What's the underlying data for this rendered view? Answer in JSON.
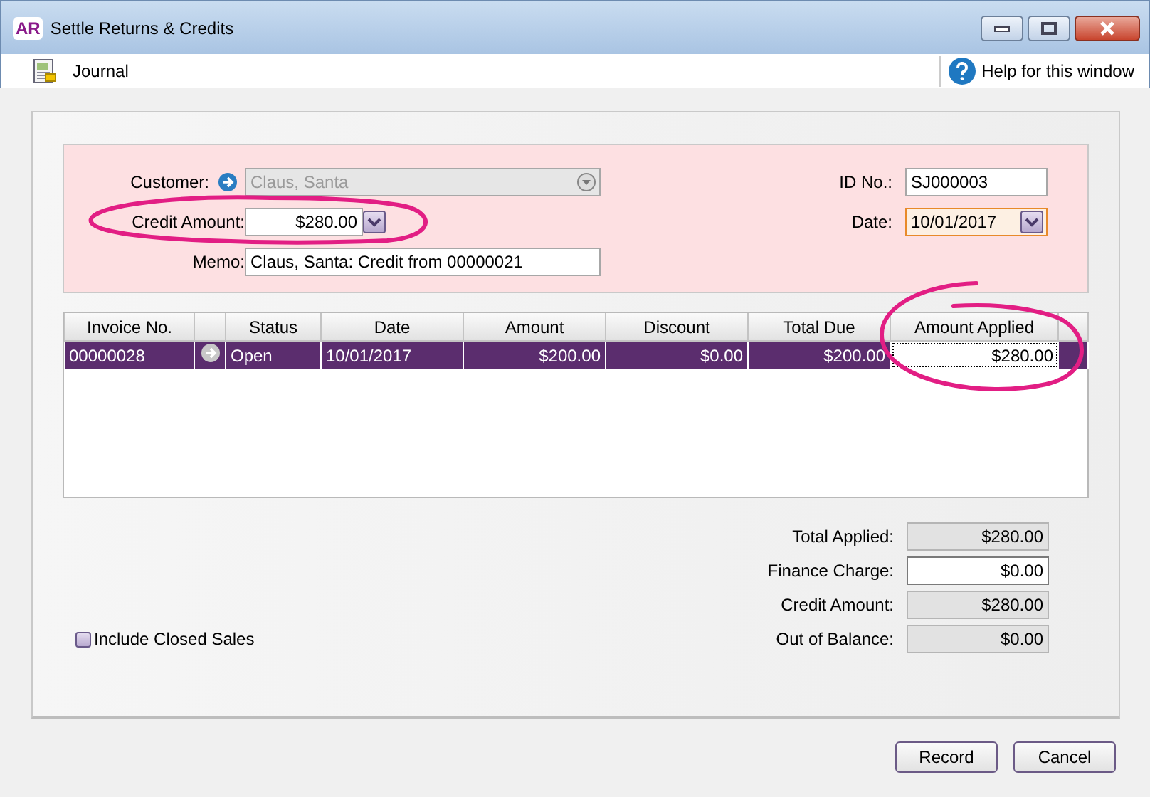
{
  "window": {
    "badge": "AR",
    "title": "Settle Returns & Credits"
  },
  "toolbar": {
    "journal": "Journal",
    "help": "Help for this window"
  },
  "form": {
    "customer": {
      "label": "Customer:",
      "value": "Claus, Santa",
      "disabled": true
    },
    "credit_amount": {
      "label": "Credit Amount:",
      "value": "$280.00"
    },
    "memo": {
      "label": "Memo:",
      "value": "Claus, Santa: Credit from 00000021"
    },
    "id_no": {
      "label": "ID No.:",
      "value": "SJ000003"
    },
    "date": {
      "label": "Date:",
      "value": "10/01/2017",
      "focused": true
    }
  },
  "table": {
    "columns": [
      {
        "kind": "text",
        "label": "Invoice No."
      },
      {
        "kind": "link"
      },
      {
        "kind": "text",
        "label": "Status"
      },
      {
        "kind": "text",
        "label": "Date"
      },
      {
        "kind": "money",
        "label": "Amount"
      },
      {
        "kind": "money",
        "label": "Discount"
      },
      {
        "kind": "money",
        "label": "Total Due"
      },
      {
        "kind": "edit",
        "label": "Amount Applied"
      }
    ],
    "rows": [
      {
        "cells": [
          "00000028",
          "",
          "Open",
          "10/01/2017",
          "$200.00",
          "$0.00",
          "$200.00",
          "$280.00"
        ],
        "selected": true,
        "editing": true
      }
    ]
  },
  "include_closed_sales": {
    "label": "Include Closed Sales",
    "checked": false
  },
  "totals": [
    {
      "label": "Total Applied:",
      "value": "$280.00",
      "editable": false
    },
    {
      "label": "Finance Charge:",
      "value": "$0.00",
      "editable": true
    },
    {
      "label": "Credit Amount:",
      "value": "$280.00",
      "editable": false
    },
    {
      "label": "Out of Balance:",
      "value": "$0.00",
      "editable": false
    }
  ],
  "buttons": [
    "Record",
    "Cancel"
  ]
}
